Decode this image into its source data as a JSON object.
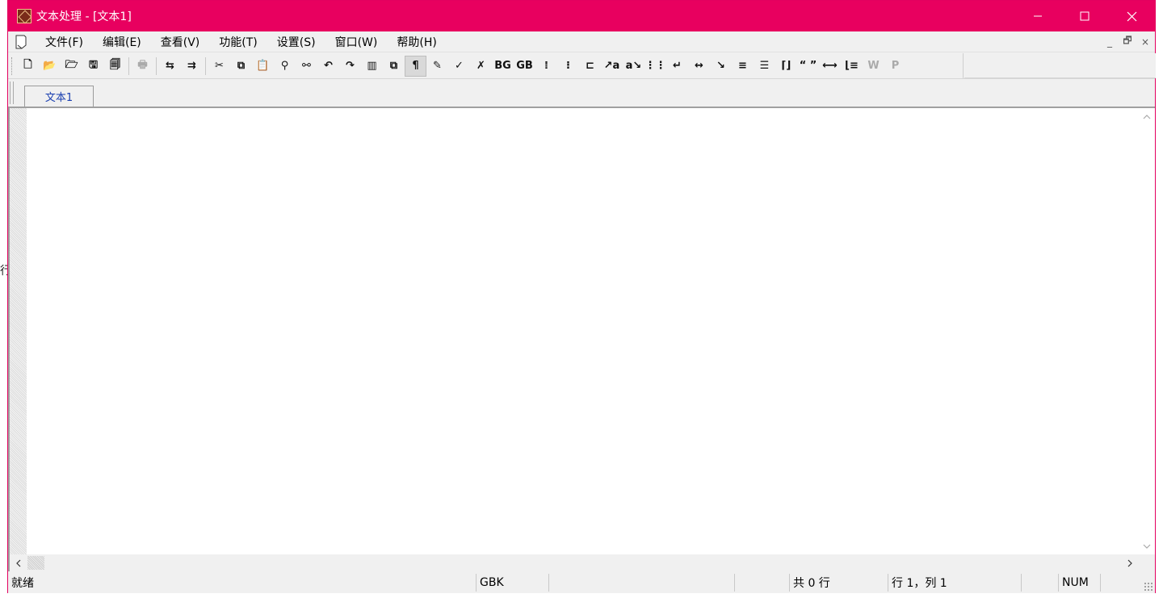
{
  "window": {
    "title": "文本处理 - [文本1]",
    "accent_color": "#e8005f",
    "icons": {
      "app": "app-logo-icon",
      "minimize": "minimize-icon",
      "maximize": "maximize-icon",
      "close": "close-icon"
    }
  },
  "menubar": {
    "items": [
      "文件(F)",
      "编辑(E)",
      "查看(V)",
      "功能(T)",
      "设置(S)",
      "窗口(W)",
      "帮助(H)"
    ],
    "mdi_controls": [
      "_",
      "🗗",
      "×"
    ]
  },
  "toolbar": {
    "buttons": [
      {
        "icon": "new-file-icon",
        "glyph": "🗋"
      },
      {
        "icon": "open-folder-icon",
        "glyph": "📂"
      },
      {
        "icon": "open-recent-icon",
        "glyph": "🗁"
      },
      {
        "icon": "save-icon",
        "glyph": "🖫"
      },
      {
        "icon": "save-all-icon",
        "glyph": "🗐"
      },
      {
        "sep": true
      },
      {
        "icon": "print-icon",
        "glyph": "🖶",
        "disabled": true
      },
      {
        "sep": true
      },
      {
        "icon": "convert-icon",
        "glyph": "⇆"
      },
      {
        "icon": "batch-convert-icon",
        "glyph": "⇉"
      },
      {
        "sep": true
      },
      {
        "icon": "cut-icon",
        "glyph": "✂"
      },
      {
        "icon": "copy-icon",
        "glyph": "⧉"
      },
      {
        "icon": "paste-icon",
        "glyph": "📋"
      },
      {
        "icon": "find-icon",
        "glyph": "⚲"
      },
      {
        "icon": "find-replace-icon",
        "glyph": "⚯"
      },
      {
        "icon": "undo-icon",
        "glyph": "↶"
      },
      {
        "icon": "redo-icon",
        "glyph": "↷"
      },
      {
        "icon": "columns-icon",
        "glyph": "▥"
      },
      {
        "icon": "clone-icon",
        "glyph": "⧉"
      },
      {
        "icon": "paragraph-mark-icon",
        "glyph": "¶",
        "pressed": true
      },
      {
        "icon": "tool-1-icon",
        "glyph": "✎"
      },
      {
        "icon": "tool-2-icon",
        "glyph": "✓"
      },
      {
        "icon": "tool-3-icon",
        "glyph": "✗"
      },
      {
        "icon": "big5-to-gb-icon",
        "glyph": "BG"
      },
      {
        "icon": "gb-to-big5-icon",
        "glyph": "GB"
      },
      {
        "icon": "tool-4-icon",
        "glyph": "⁞"
      },
      {
        "icon": "tool-5-icon",
        "glyph": "⁝"
      },
      {
        "icon": "tool-6-icon",
        "glyph": "⊏"
      },
      {
        "icon": "tool-7-icon",
        "glyph": "↗a"
      },
      {
        "icon": "tool-8-icon",
        "glyph": "a↘"
      },
      {
        "icon": "tool-9-icon",
        "glyph": "⋮⋮"
      },
      {
        "icon": "tool-10-icon",
        "glyph": "↵"
      },
      {
        "icon": "tool-11-icon",
        "glyph": "↔"
      },
      {
        "icon": "tool-12-icon",
        "glyph": "↘"
      },
      {
        "icon": "align-icon",
        "glyph": "≡"
      },
      {
        "icon": "tool-13-icon",
        "glyph": "☰"
      },
      {
        "icon": "bracket-icon",
        "glyph": "⌈⌋"
      },
      {
        "icon": "quotes-icon",
        "glyph": "“ ”"
      },
      {
        "icon": "width-icon",
        "glyph": "⟷"
      },
      {
        "icon": "tool-14-icon",
        "glyph": "⌊≡"
      },
      {
        "icon": "w-icon",
        "glyph": "W",
        "disabled": true
      },
      {
        "icon": "p-icon",
        "glyph": "P",
        "disabled": true
      }
    ]
  },
  "tabs": [
    {
      "label": "文本1"
    }
  ],
  "editor": {
    "content": ""
  },
  "statusbar": {
    "message": "就绪",
    "encoding": "GBK",
    "empty_1": "",
    "empty_2": "",
    "line_count": "共 0 行",
    "cursor": "行 1，列 1",
    "empty_3": "",
    "num_lock": "NUM"
  },
  "stray_text": "行"
}
